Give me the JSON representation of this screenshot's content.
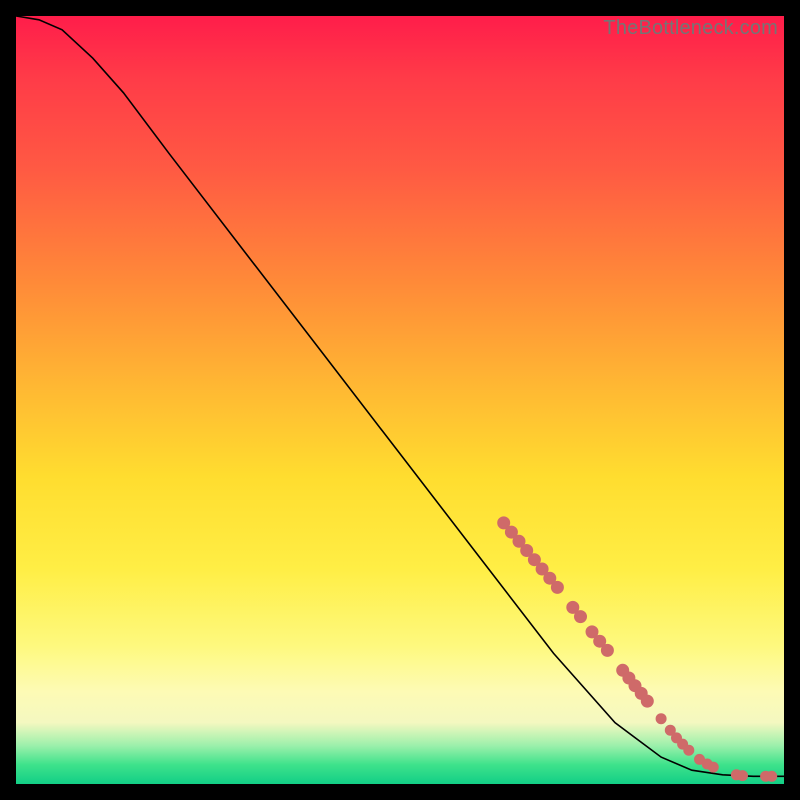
{
  "watermark": "TheBottleneck.com",
  "colors": {
    "marker": "#cf6a69",
    "curve": "#000000"
  },
  "chart_data": {
    "type": "line",
    "title": "",
    "xlabel": "",
    "ylabel": "",
    "xlim": [
      0,
      100
    ],
    "ylim": [
      0,
      100
    ],
    "curve": [
      {
        "x": 0,
        "y": 100
      },
      {
        "x": 3,
        "y": 99.5
      },
      {
        "x": 6,
        "y": 98.2
      },
      {
        "x": 10,
        "y": 94.5
      },
      {
        "x": 14,
        "y": 90
      },
      {
        "x": 20,
        "y": 82
      },
      {
        "x": 30,
        "y": 69
      },
      {
        "x": 40,
        "y": 56
      },
      {
        "x": 50,
        "y": 43
      },
      {
        "x": 60,
        "y": 30
      },
      {
        "x": 70,
        "y": 17
      },
      {
        "x": 78,
        "y": 8
      },
      {
        "x": 84,
        "y": 3.5
      },
      {
        "x": 88,
        "y": 1.8
      },
      {
        "x": 92,
        "y": 1.2
      },
      {
        "x": 96,
        "y": 1.0
      },
      {
        "x": 100,
        "y": 1.0
      }
    ],
    "markers": [
      {
        "x": 63.5,
        "y": 34.0,
        "r": 6
      },
      {
        "x": 64.5,
        "y": 32.8,
        "r": 6
      },
      {
        "x": 65.5,
        "y": 31.6,
        "r": 6
      },
      {
        "x": 66.5,
        "y": 30.4,
        "r": 6
      },
      {
        "x": 67.5,
        "y": 29.2,
        "r": 6
      },
      {
        "x": 68.5,
        "y": 28.0,
        "r": 6
      },
      {
        "x": 69.5,
        "y": 26.8,
        "r": 6
      },
      {
        "x": 70.5,
        "y": 25.6,
        "r": 6
      },
      {
        "x": 72.5,
        "y": 23.0,
        "r": 6
      },
      {
        "x": 73.5,
        "y": 21.8,
        "r": 6
      },
      {
        "x": 75.0,
        "y": 19.8,
        "r": 6
      },
      {
        "x": 76.0,
        "y": 18.6,
        "r": 6
      },
      {
        "x": 77.0,
        "y": 17.4,
        "r": 6
      },
      {
        "x": 79.0,
        "y": 14.8,
        "r": 6
      },
      {
        "x": 79.8,
        "y": 13.8,
        "r": 6
      },
      {
        "x": 80.6,
        "y": 12.8,
        "r": 6
      },
      {
        "x": 81.4,
        "y": 11.8,
        "r": 6
      },
      {
        "x": 82.2,
        "y": 10.8,
        "r": 6
      },
      {
        "x": 84.0,
        "y": 8.5,
        "r": 5
      },
      {
        "x": 85.2,
        "y": 7.0,
        "r": 5
      },
      {
        "x": 86.0,
        "y": 6.0,
        "r": 5
      },
      {
        "x": 86.8,
        "y": 5.2,
        "r": 5
      },
      {
        "x": 87.6,
        "y": 4.4,
        "r": 5
      },
      {
        "x": 89.0,
        "y": 3.2,
        "r": 5
      },
      {
        "x": 90.0,
        "y": 2.6,
        "r": 5
      },
      {
        "x": 90.8,
        "y": 2.2,
        "r": 5
      },
      {
        "x": 93.8,
        "y": 1.2,
        "r": 5
      },
      {
        "x": 94.6,
        "y": 1.1,
        "r": 5
      },
      {
        "x": 97.6,
        "y": 1.0,
        "r": 5
      },
      {
        "x": 98.4,
        "y": 1.0,
        "r": 5
      }
    ]
  }
}
